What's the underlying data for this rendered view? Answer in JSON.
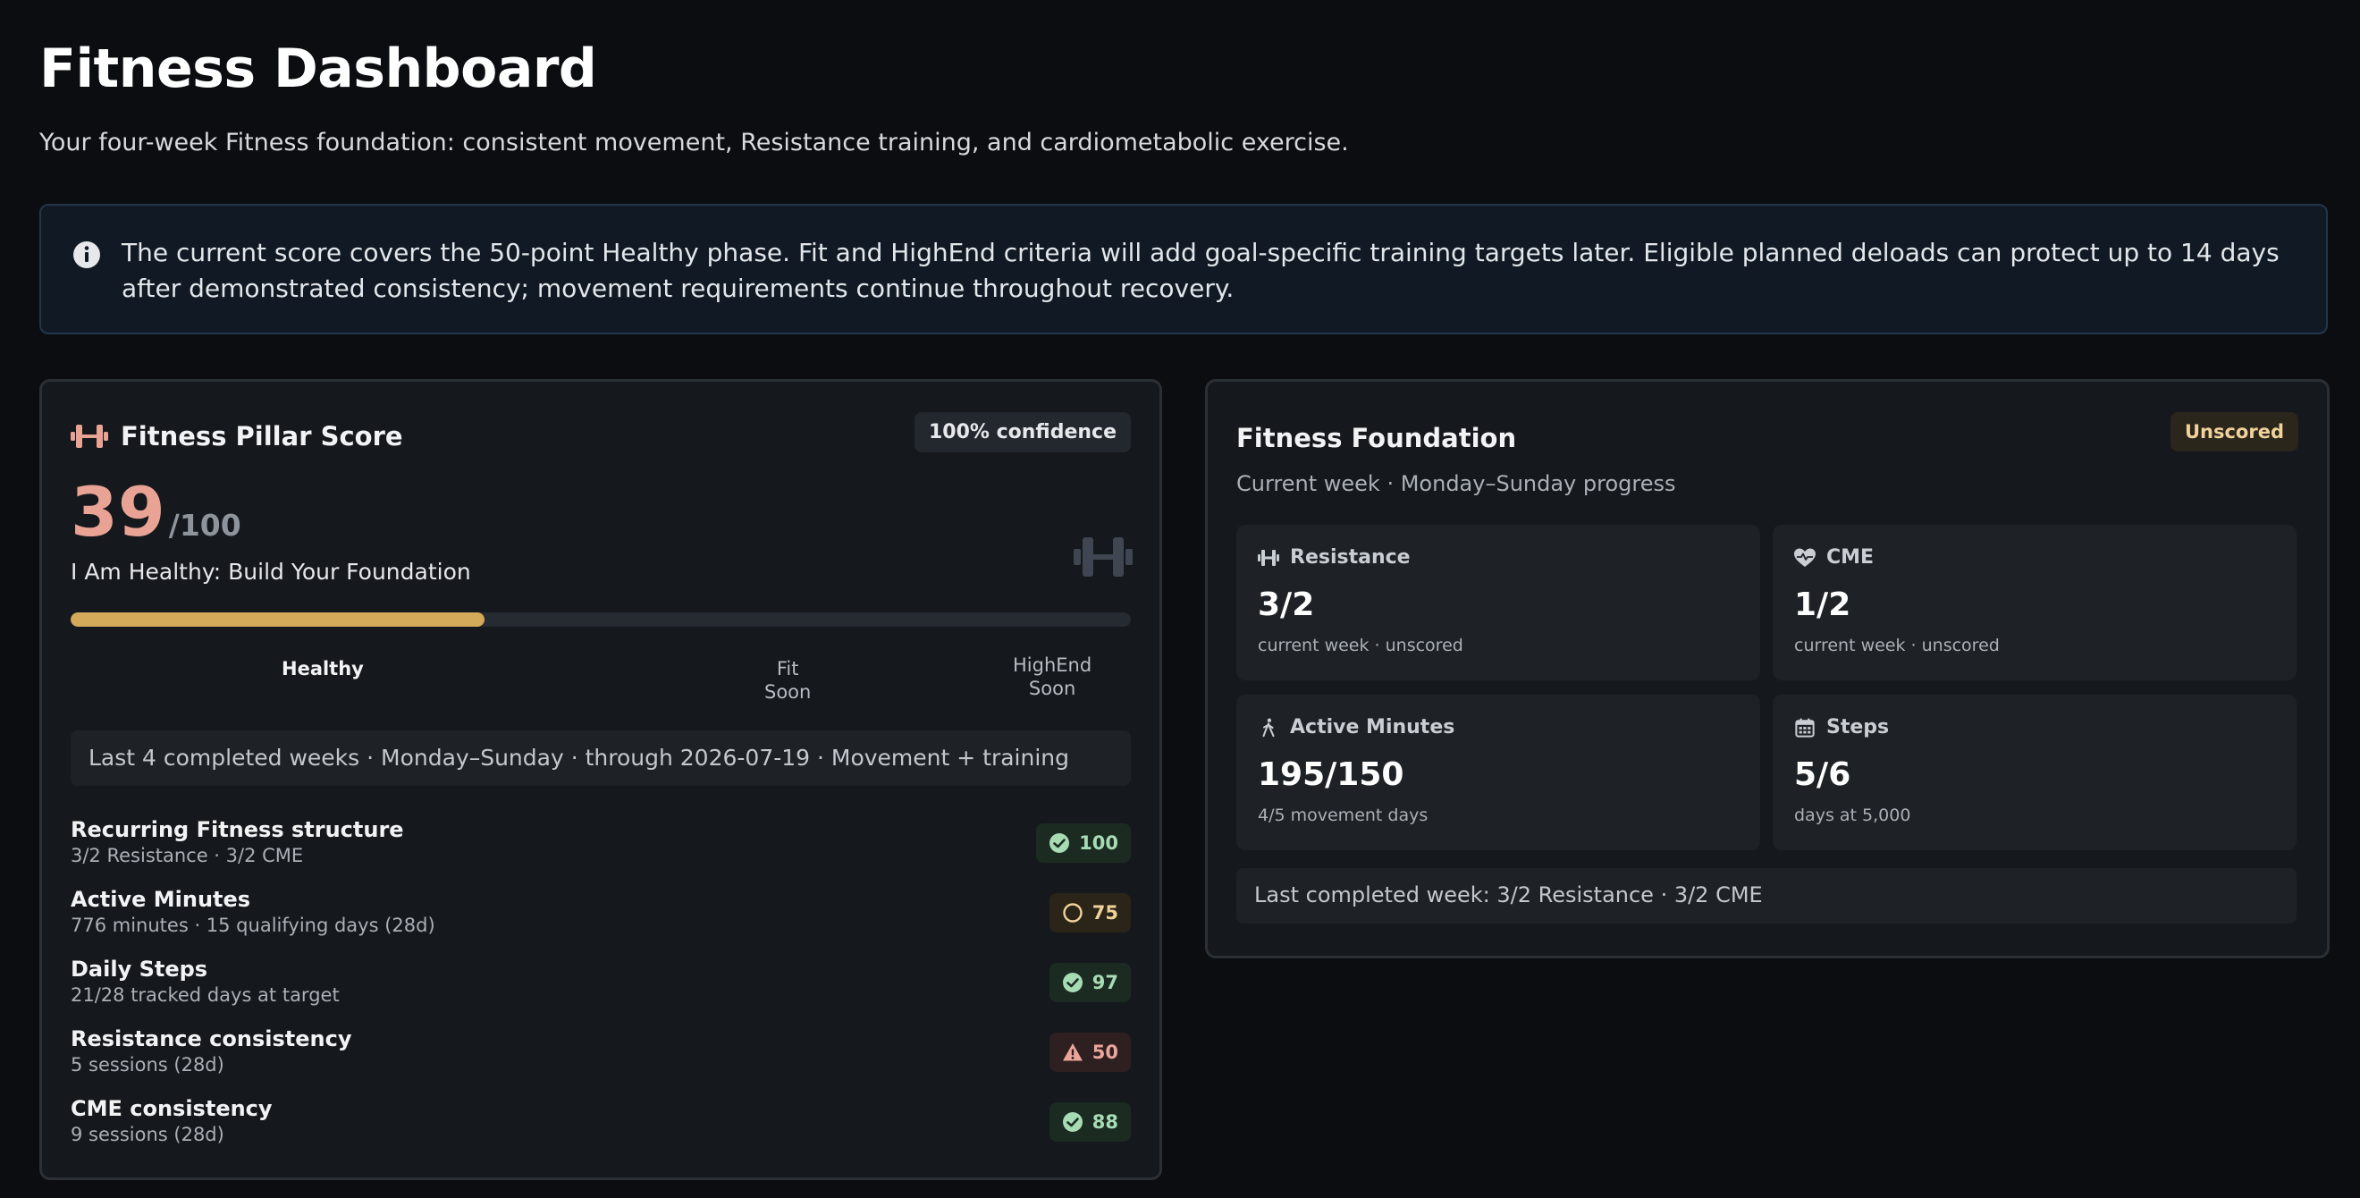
{
  "page": {
    "title": "Fitness Dashboard",
    "subtitle": "Your four-week Fitness foundation: consistent movement, Resistance training, and cardiometabolic exercise."
  },
  "info_banner": {
    "icon": "info-icon",
    "text": "The current score covers the 50-point Healthy phase. Fit and HighEnd criteria will add goal-specific training targets later. Eligible planned deloads can protect up to 14 days after demonstrated consistency; movement requirements continue throughout recovery."
  },
  "score_card": {
    "icon": "dumbbell-icon",
    "title": "Fitness Pillar Score",
    "confidence": "100% confidence",
    "score": "39",
    "score_max": "/100",
    "phase_label": "I Am Healthy: Build Your Foundation",
    "progress_fraction": 0.39,
    "phases": {
      "healthy": "Healthy",
      "fit": "Fit",
      "fit_status": "Soon",
      "highend": "HighEnd",
      "highend_status": "Soon"
    },
    "window": "Last 4 completed weeks · Monday–Sunday · through 2026-07-19 · Movement + training",
    "criteria": [
      {
        "title": "Recurring Fitness structure",
        "detail": "3/2 Resistance · 3/2 CME",
        "score": "100",
        "status": "ok"
      },
      {
        "title": "Active Minutes",
        "detail": "776 minutes · 15 qualifying days (28d)",
        "score": "75",
        "status": "partial"
      },
      {
        "title": "Daily Steps",
        "detail": "21/28 tracked days at target",
        "score": "97",
        "status": "ok"
      },
      {
        "title": "Resistance consistency",
        "detail": "5 sessions (28d)",
        "score": "50",
        "status": "warning"
      },
      {
        "title": "CME consistency",
        "detail": "9 sessions (28d)",
        "score": "88",
        "status": "ok"
      }
    ]
  },
  "foundation_card": {
    "title": "Fitness Foundation",
    "subtitle": "Current week · Monday–Sunday progress",
    "status_badge": "Unscored",
    "tiles": [
      {
        "icon": "dumbbell-icon",
        "label": "Resistance",
        "value": "3/2",
        "caption": "current week · unscored"
      },
      {
        "icon": "heart-pulse-icon",
        "label": "CME",
        "value": "1/2",
        "caption": "current week · unscored"
      },
      {
        "icon": "walking-icon",
        "label": "Active Minutes",
        "value": "195/150",
        "caption": "4/5 movement days"
      },
      {
        "icon": "calendar-icon",
        "label": "Steps",
        "value": "5/6",
        "caption": "days at 5,000"
      }
    ],
    "last_week": "Last completed week: 3/2 Resistance · 3/2 CME"
  },
  "colors": {
    "background": "#0b0d10",
    "accent_score": "#e8a395",
    "progress_fill": "#d3a95a",
    "ok": "#a6dbb4",
    "partial": "#f0d29a",
    "warning": "#eba59a"
  }
}
